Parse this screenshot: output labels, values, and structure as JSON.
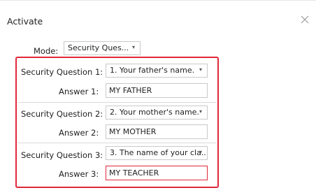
{
  "dialog": {
    "title": "Activate",
    "close_icon": "close-icon"
  },
  "mode": {
    "label": "Mode:",
    "selected": "Security Ques..."
  },
  "questions": [
    {
      "label": "Security Question 1:",
      "selected": "1. Your father's name.",
      "answer_label": "Answer 1:",
      "answer_value": "MY FATHER"
    },
    {
      "label": "Security Question 2:",
      "selected": "2. Your mother's name.",
      "answer_label": "Answer 2:",
      "answer_value": "MY MOTHER"
    },
    {
      "label": "Security Question 3:",
      "selected": "3. The name of your cla...",
      "answer_label": "Answer 3:",
      "answer_value": "MY TEACHER"
    }
  ],
  "colors": {
    "highlight": "#e0283a",
    "border": "#c9c9c9"
  }
}
